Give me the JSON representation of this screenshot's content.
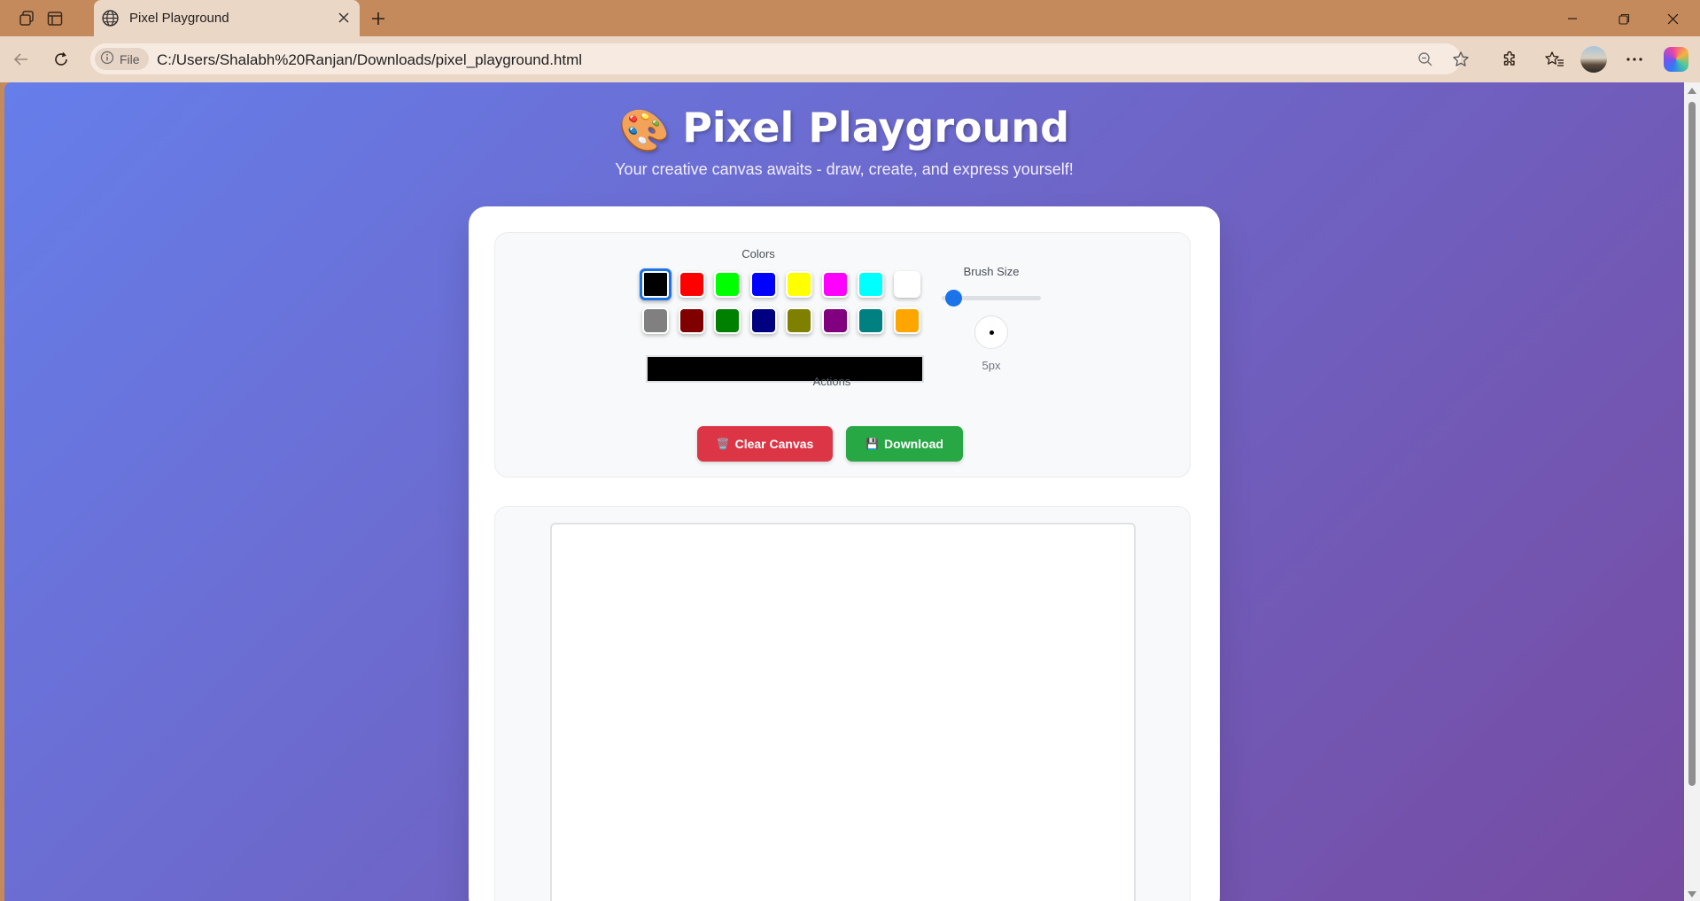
{
  "browser": {
    "tab_title": "Pixel Playground",
    "file_chip": "File",
    "url": "C:/Users/Shalabh%20Ranjan/Downloads/pixel_playground.html"
  },
  "page": {
    "title_emoji": "🎨",
    "title": "Pixel Playground",
    "subtitle": "Your creative canvas awaits - draw, create, and express yourself!",
    "colors_label": "Colors",
    "palette": [
      "#000000",
      "#ff0000",
      "#00ff00",
      "#0000ff",
      "#ffff00",
      "#ff00ff",
      "#00ffff",
      "#ffffff",
      "#808080",
      "#800000",
      "#008000",
      "#000080",
      "#808000",
      "#800080",
      "#008080",
      "#ffa500"
    ],
    "selected_color": "#000000",
    "brush_size_label": "Brush Size",
    "brush_size_value": "5px",
    "actions_label": "Actions",
    "clear_icon": "🗑️",
    "clear_label": "Clear Canvas",
    "download_icon": "💾",
    "download_label": "Download",
    "accent_color": "#1a73e8"
  }
}
